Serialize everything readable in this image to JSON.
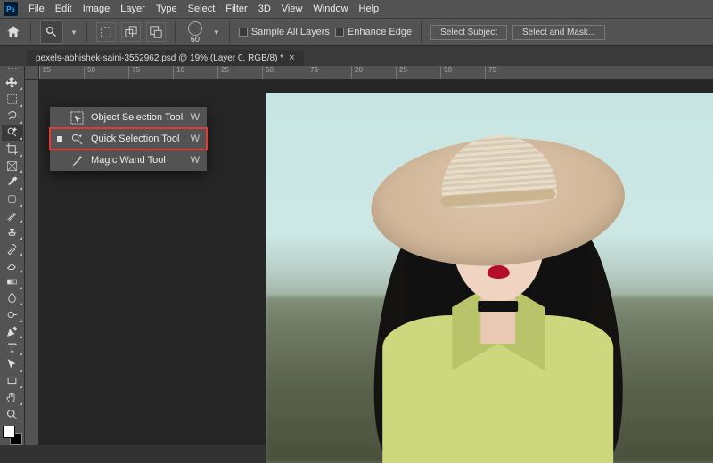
{
  "app": {
    "logo": "Ps"
  },
  "menu": {
    "items": [
      "File",
      "Edit",
      "Image",
      "Layer",
      "Type",
      "Select",
      "Filter",
      "3D",
      "View",
      "Window",
      "Help"
    ]
  },
  "options": {
    "brush_size": "60",
    "sample_all_layers": "Sample All Layers",
    "enhance_edge": "Enhance Edge",
    "select_subject": "Select Subject",
    "select_and_mask": "Select and Mask..."
  },
  "tab": {
    "title": "pexels-abhishek-saini-3552962.psd @ 19% (Layer 0, RGB/8) *",
    "close": "×"
  },
  "ruler": {
    "marks": [
      "25",
      "50",
      "75",
      "10",
      "25",
      "50",
      "75",
      "20",
      "25",
      "50",
      "75"
    ]
  },
  "flyout": {
    "items": [
      {
        "label": "Object Selection Tool",
        "shortcut": "W",
        "selected": false,
        "highlight": false
      },
      {
        "label": "Quick Selection Tool",
        "shortcut": "W",
        "selected": true,
        "highlight": true
      },
      {
        "label": "Magic Wand Tool",
        "shortcut": "W",
        "selected": false,
        "highlight": false
      }
    ]
  },
  "tools": [
    "move",
    "marquee",
    "lasso",
    "quick-select",
    "crop",
    "frame",
    "eyedropper",
    "spot-heal",
    "brush",
    "clone",
    "history-brush",
    "eraser",
    "gradient",
    "blur",
    "dodge",
    "pen",
    "type",
    "path-select",
    "rectangle",
    "hand",
    "zoom"
  ]
}
